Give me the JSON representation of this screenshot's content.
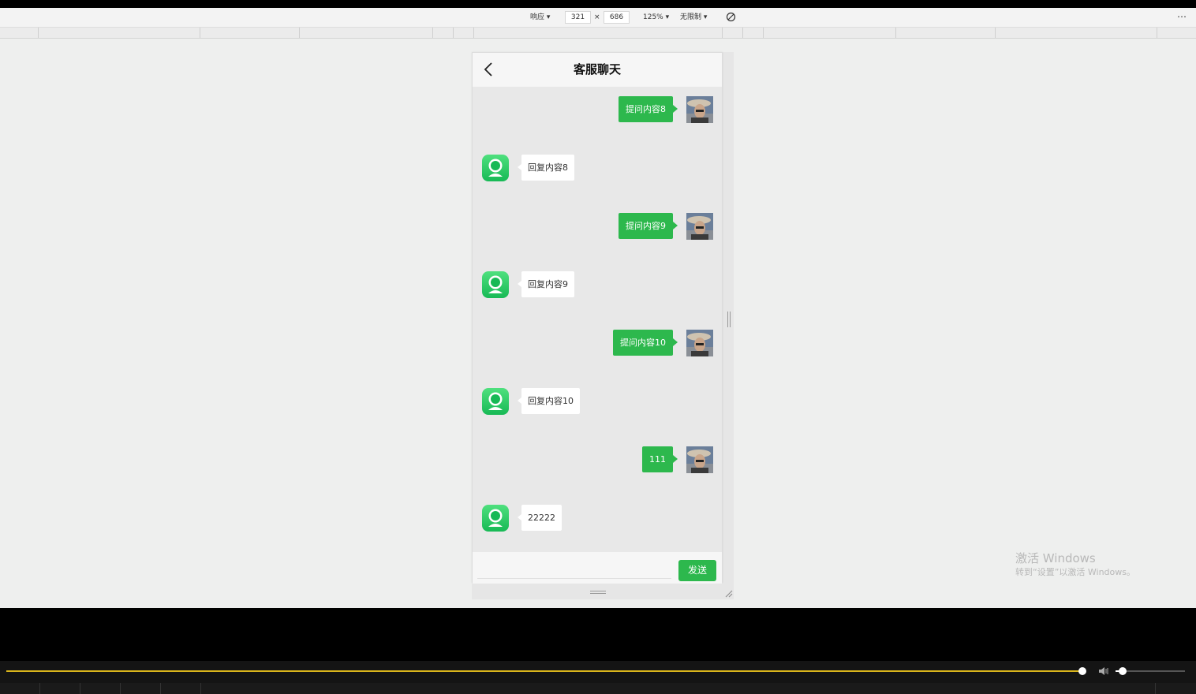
{
  "devtools": {
    "device_label": "响应 ▾",
    "width_value": "321",
    "times_sign": "×",
    "height_value": "686",
    "zoom_label": "125% ▾",
    "throttle_label": "无限制 ▾",
    "rotate_icon": "rotate-icon",
    "more_icon": "⋯"
  },
  "header": {
    "title": "客服聊天",
    "back_icon": "chevron-left-icon"
  },
  "messages": [
    {
      "role": "user",
      "text": "提问内容8"
    },
    {
      "role": "bot",
      "text": "回复内容8"
    },
    {
      "role": "user",
      "text": "提问内容9"
    },
    {
      "role": "bot",
      "text": "回复内容9"
    },
    {
      "role": "user",
      "text": "提问内容10"
    },
    {
      "role": "bot",
      "text": "回复内容10"
    },
    {
      "role": "user",
      "text": "111"
    },
    {
      "role": "bot",
      "text": "22222"
    }
  ],
  "input": {
    "value": "",
    "placeholder": ""
  },
  "send_button_label": "发送",
  "watermark": {
    "line1": "激活 Windows",
    "line2": "转到“设置”以激活 Windows。"
  },
  "player": {
    "progress_fraction": 0.9,
    "volume_fraction": 0.1,
    "volume_icon": "volume-icon"
  },
  "colors": {
    "accent_green": "#2db84d",
    "progress_yellow": "#d9b51c"
  }
}
